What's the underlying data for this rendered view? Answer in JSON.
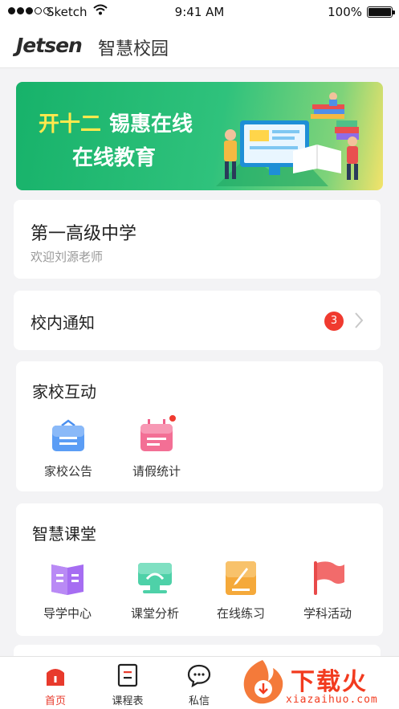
{
  "status_bar": {
    "carrier": "Sketch",
    "time": "9:41 AM",
    "battery": "100%",
    "signal_icon": "signal-dots-icon",
    "wifi_icon": "wifi-icon",
    "battery_icon": "battery-icon"
  },
  "header": {
    "logo": "Jetsen",
    "title": "智慧校园"
  },
  "banner": {
    "highlight": "开十二",
    "line1_rest": "锡惠在线",
    "line2": "在线教育"
  },
  "school": {
    "name": "第一高级中学",
    "welcome": "欢迎刘源老师"
  },
  "notice": {
    "title": "校内通知",
    "count": "3"
  },
  "home_school": {
    "title": "家校互动",
    "items": [
      {
        "label": "家校公告",
        "icon": "announcement-icon"
      },
      {
        "label": "请假统计",
        "icon": "calendar-icon"
      }
    ]
  },
  "smart_class": {
    "title": "智慧课堂",
    "items": [
      {
        "label": "导学中心",
        "icon": "book-icon"
      },
      {
        "label": "课堂分析",
        "icon": "monitor-icon"
      },
      {
        "label": "在线练习",
        "icon": "exercise-icon"
      },
      {
        "label": "学科活动",
        "icon": "flag-icon"
      }
    ]
  },
  "tabbar": {
    "items": [
      {
        "label": "首页",
        "active": true
      },
      {
        "label": "课程表",
        "active": false
      },
      {
        "label": "私信",
        "active": false
      }
    ]
  },
  "watermark": {
    "text": "下载火",
    "sub": "xiazaihuo.com"
  },
  "colors": {
    "accent": "#e83a2c",
    "banner_green": "#17b26a",
    "badge": "#f03a2f"
  }
}
